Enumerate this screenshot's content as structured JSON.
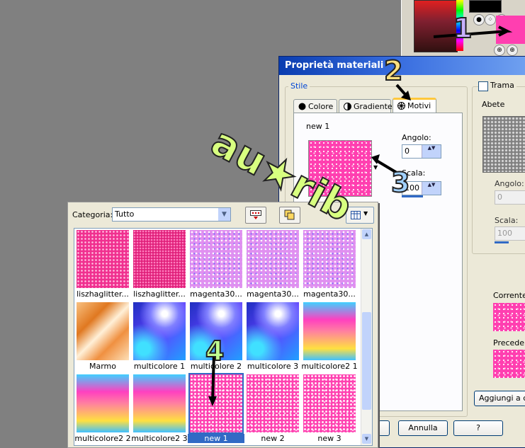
{
  "dialog": {
    "title": "Proprietà materiali",
    "stile_label": "Stile",
    "tabs": [
      {
        "label": "Colore",
        "icon": "color-circle-icon"
      },
      {
        "label": "Gradiente",
        "icon": "gradient-icon"
      },
      {
        "label": "Motivi",
        "icon": "pattern-icon",
        "active": true
      }
    ],
    "pattern_name": "new 1",
    "angle_label": "Angolo:",
    "angle_value": "0",
    "scale_label": "Scala:",
    "scale_value": "100",
    "texture_check_label": "Trama",
    "texture_name": "Abete",
    "texture_angle_label": "Angolo:",
    "texture_angle_value": "0",
    "texture_scale_label": "Scala:",
    "texture_scale_value": "100",
    "current_label": "Corrente:",
    "previous_label": "Precedente",
    "add_button": "Aggiungi a campioni",
    "cancel_button": "Annulla",
    "help_button": "?"
  },
  "picker": {
    "category_label": "Categoria:",
    "category_value": "Tutto",
    "items": [
      {
        "label": "liszhaglitter...",
        "texture": "pink1"
      },
      {
        "label": "liszhaglitter...",
        "texture": "pink2"
      },
      {
        "label": "magenta30...",
        "texture": "mag"
      },
      {
        "label": "magenta30...",
        "texture": "mag"
      },
      {
        "label": "magenta30...",
        "texture": "mag"
      },
      {
        "label": "Marmo",
        "texture": "marmo"
      },
      {
        "label": "multicolore 1",
        "texture": "multi"
      },
      {
        "label": "multicolore 2",
        "texture": "multi"
      },
      {
        "label": "multicolore 3",
        "texture": "multi"
      },
      {
        "label": "multicolore2 1",
        "texture": "rainbow"
      },
      {
        "label": "multicolore2 2",
        "texture": "rainbow"
      },
      {
        "label": "multicolore2 3",
        "texture": "rainbow"
      },
      {
        "label": "new 1",
        "texture": "new",
        "selected": true
      },
      {
        "label": "new 2",
        "texture": "new"
      },
      {
        "label": "new 3",
        "texture": "new"
      }
    ]
  },
  "annotations": {
    "watermark": "au★rib",
    "step1": "1",
    "step2": "2",
    "step3": "3",
    "step4": "4"
  }
}
